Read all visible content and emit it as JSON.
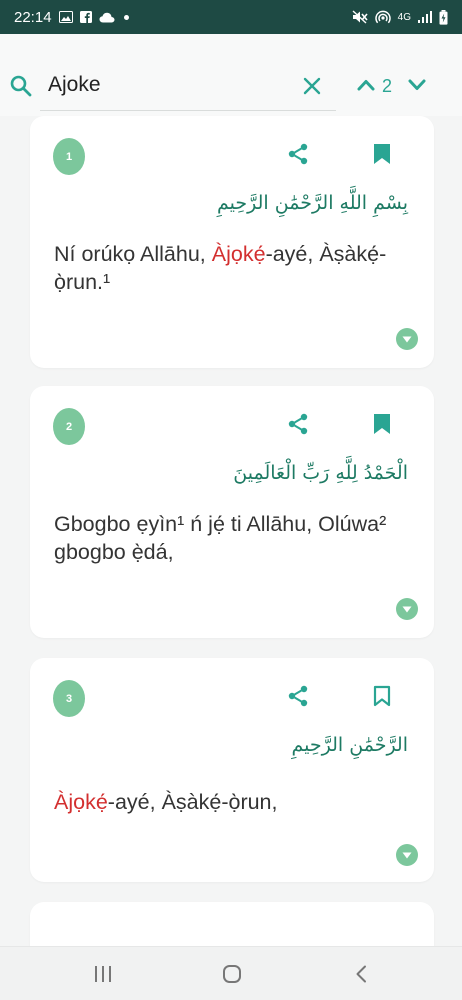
{
  "status_bar": {
    "time": "22:14",
    "left_icons": [
      "image-icon",
      "facebook-icon",
      "cloud-icon",
      "notification-dot-icon"
    ],
    "right_icons": [
      "mute-icon",
      "hotspot-icon",
      "signal-icon",
      "battery-charging-icon"
    ],
    "network": "4G"
  },
  "search": {
    "query": "Ajoke",
    "current_match": "2",
    "accent_color": "#2aa593"
  },
  "verses": [
    {
      "number": "1",
      "arabic": "بِسْمِ اللَّهِ الرَّحْمَٰنِ الرَّحِيمِ",
      "pre": "Ní orúkọ Allāhu, ",
      "highlight": "Àjọkẹ́",
      "post": "-ayé, Àṣàkẹ́-ọ̀run.¹",
      "bookmarked": true
    },
    {
      "number": "2",
      "arabic": "الْحَمْدُ لِلَّهِ رَبِّ الْعَالَمِينَ",
      "pre": "Gbogbo ẹyìn¹ ń jẹ́ ti Allāhu, Olúwa² gbogbo ẹ̀dá,",
      "highlight": "",
      "post": "",
      "bookmarked": true
    },
    {
      "number": "3",
      "arabic": "الرَّحْمَٰنِ الرَّحِيمِ",
      "pre": "",
      "highlight": "Àjọkẹ́",
      "post": "-ayé, Àṣàkẹ́-ọ̀run,",
      "bookmarked": false
    }
  ],
  "colors": {
    "status_bar": "#1e4a44",
    "badge": "#7cc79c",
    "icon": "#2aa593",
    "arabic": "#1d7a63",
    "highlight": "#d32f2f"
  }
}
